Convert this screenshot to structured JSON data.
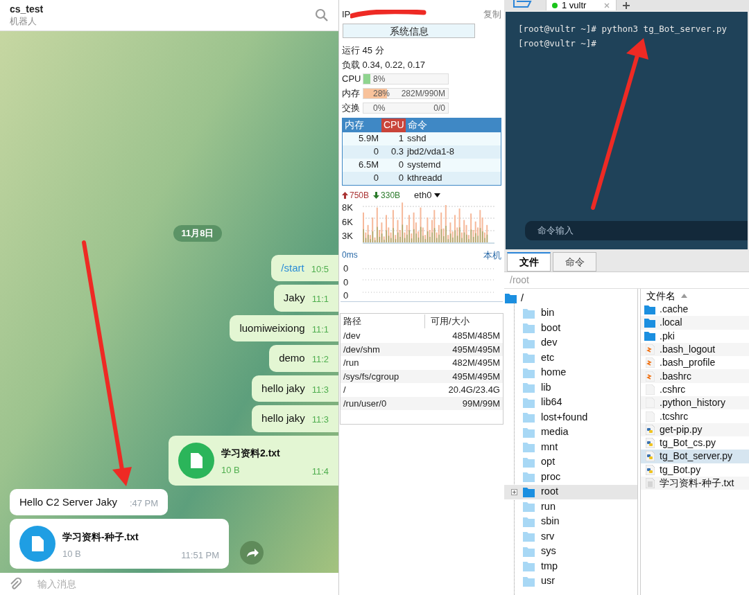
{
  "chat": {
    "title": "cs_test",
    "subtitle": "机器人",
    "date": "11月8日",
    "messages": [
      {
        "kind": "text",
        "outgoing": true,
        "command": true,
        "text": "/start",
        "time": "10:5"
      },
      {
        "kind": "text",
        "outgoing": true,
        "command": false,
        "text": "Jaky",
        "time": "11:1"
      },
      {
        "kind": "text",
        "outgoing": true,
        "command": false,
        "text": "luomiweixiong",
        "time": "11:1"
      },
      {
        "kind": "text",
        "outgoing": true,
        "command": false,
        "text": "demo",
        "time": "11:2"
      },
      {
        "kind": "text",
        "outgoing": true,
        "command": false,
        "text": "hello jaky",
        "time": "11:3"
      },
      {
        "kind": "text",
        "outgoing": true,
        "command": false,
        "text": "hello jaky",
        "time": "11:3"
      },
      {
        "kind": "file",
        "outgoing": true,
        "name": "学习资料2.txt",
        "size": "10 B",
        "time": "11:4"
      },
      {
        "kind": "text",
        "outgoing": false,
        "command": false,
        "text": "Hello C2 Server Jaky",
        "time": ":47 PM"
      },
      {
        "kind": "file",
        "outgoing": false,
        "name": "学习资料-种子.txt",
        "size": "10 B",
        "time": "11:51 PM"
      }
    ],
    "input_placeholder": "输入消息"
  },
  "monitor": {
    "ip_label": "IP",
    "copy": "复制",
    "sysinfo_button": "系统信息",
    "uptime": "运行 45 分",
    "load": "负载 0.34, 0.22, 0.17",
    "meters": [
      {
        "label": "CPU",
        "level": 0.08,
        "percent": "8%"
      },
      {
        "label": "内存",
        "level": 0.28,
        "percent": "28%",
        "detail": "282M/990M"
      },
      {
        "label": "交换",
        "level": 0,
        "percent": "0%",
        "detail": "0/0"
      }
    ],
    "process_columns": [
      "内存",
      "CPU",
      "命令"
    ],
    "processes": [
      {
        "mem": "5.9M",
        "cpu": "1",
        "cmd": "sshd"
      },
      {
        "mem": "0",
        "cpu": "0.3",
        "cmd": "jbd2/vda1-8"
      },
      {
        "mem": "6.5M",
        "cpu": "0",
        "cmd": "systemd"
      },
      {
        "mem": "0",
        "cpu": "0",
        "cmd": "kthreadd"
      }
    ],
    "net": {
      "up": "750B",
      "down": "330B",
      "interface": "eth0",
      "axis": [
        "8K",
        "6K",
        "3K"
      ]
    },
    "latency": {
      "value": "0ms",
      "host": "本机",
      "axis": [
        "0",
        "0",
        "0"
      ]
    },
    "disk_columns": [
      "路径",
      "可用/大小"
    ],
    "disks": [
      {
        "path": "/dev",
        "usage": "485M/485M"
      },
      {
        "path": "/dev/shm",
        "usage": "495M/495M"
      },
      {
        "path": "/run",
        "usage": "482M/495M"
      },
      {
        "path": "/sys/fs/cgroup",
        "usage": "495M/495M"
      },
      {
        "path": "/",
        "usage": "20.4G/23.4G"
      },
      {
        "path": "/run/user/0",
        "usage": "99M/99M"
      }
    ]
  },
  "terminal": {
    "tab": "1 vultr",
    "lines": [
      "[root@vultr ~]# python3 tg_Bot_server.py",
      "[root@vultr ~]#"
    ],
    "command_placeholder": "命令输入"
  },
  "files": {
    "tabs": [
      {
        "label": "文件",
        "selected": true
      },
      {
        "label": "命令",
        "selected": false
      }
    ],
    "path": "/root",
    "tree": {
      "name": "/",
      "children": [
        {
          "name": "bin",
          "selected": false
        },
        {
          "name": "boot",
          "selected": false
        },
        {
          "name": "dev",
          "selected": false
        },
        {
          "name": "etc",
          "selected": false
        },
        {
          "name": "home",
          "selected": false
        },
        {
          "name": "lib",
          "selected": false
        },
        {
          "name": "lib64",
          "selected": false
        },
        {
          "name": "lost+found",
          "selected": false
        },
        {
          "name": "media",
          "selected": false
        },
        {
          "name": "mnt",
          "selected": false
        },
        {
          "name": "opt",
          "selected": false
        },
        {
          "name": "proc",
          "selected": false
        },
        {
          "name": "root",
          "selected": true
        },
        {
          "name": "run",
          "selected": false
        },
        {
          "name": "sbin",
          "selected": false
        },
        {
          "name": "srv",
          "selected": false
        },
        {
          "name": "sys",
          "selected": false
        },
        {
          "name": "tmp",
          "selected": false
        },
        {
          "name": "usr",
          "selected": false
        }
      ]
    },
    "list_header": "文件名",
    "list": [
      {
        "kind": "folder",
        "name": ".cache",
        "selected": false
      },
      {
        "kind": "folder",
        "name": ".local",
        "selected": false
      },
      {
        "kind": "folder",
        "name": ".pki",
        "selected": false
      },
      {
        "kind": "shell",
        "name": ".bash_logout",
        "selected": false
      },
      {
        "kind": "shell",
        "name": ".bash_profile",
        "selected": false
      },
      {
        "kind": "shell",
        "name": ".bashrc",
        "selected": false
      },
      {
        "kind": "blank",
        "name": ".cshrc",
        "selected": false
      },
      {
        "kind": "blank",
        "name": ".python_history",
        "selected": false
      },
      {
        "kind": "blank",
        "name": ".tcshrc",
        "selected": false
      },
      {
        "kind": "python",
        "name": "get-pip.py",
        "selected": false
      },
      {
        "kind": "python",
        "name": "tg_Bot_cs.py",
        "selected": false
      },
      {
        "kind": "python",
        "name": "tg_Bot_server.py",
        "selected": true
      },
      {
        "kind": "python",
        "name": "tg_Bot.py",
        "selected": false
      },
      {
        "kind": "text",
        "name": "学习资料-种子.txt",
        "selected": false
      }
    ]
  }
}
